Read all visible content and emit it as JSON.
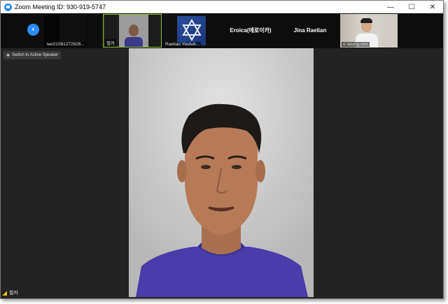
{
  "window": {
    "title": "Zoom Meeting ID: 930-919-5747"
  },
  "controls": {
    "minimize": "—",
    "maximize": "☐",
    "close": "✕"
  },
  "strip": {
    "back_icon": "‹",
    "participants": [
      {
        "name": "lee01081272626..."
      },
      {
        "name": "철카"
      },
      {
        "name": "Raelian Youtub..."
      },
      {
        "name": "Eroica(에로이카)"
      },
      {
        "name": "Jina Raelian"
      },
      {
        "name": "o seung-oon"
      }
    ]
  },
  "main": {
    "switch_label": "Switch to Active Speaker",
    "active_speaker": "철카"
  },
  "colors": {
    "accent": "#2d8cff",
    "highlight": "#8fbf3a"
  }
}
